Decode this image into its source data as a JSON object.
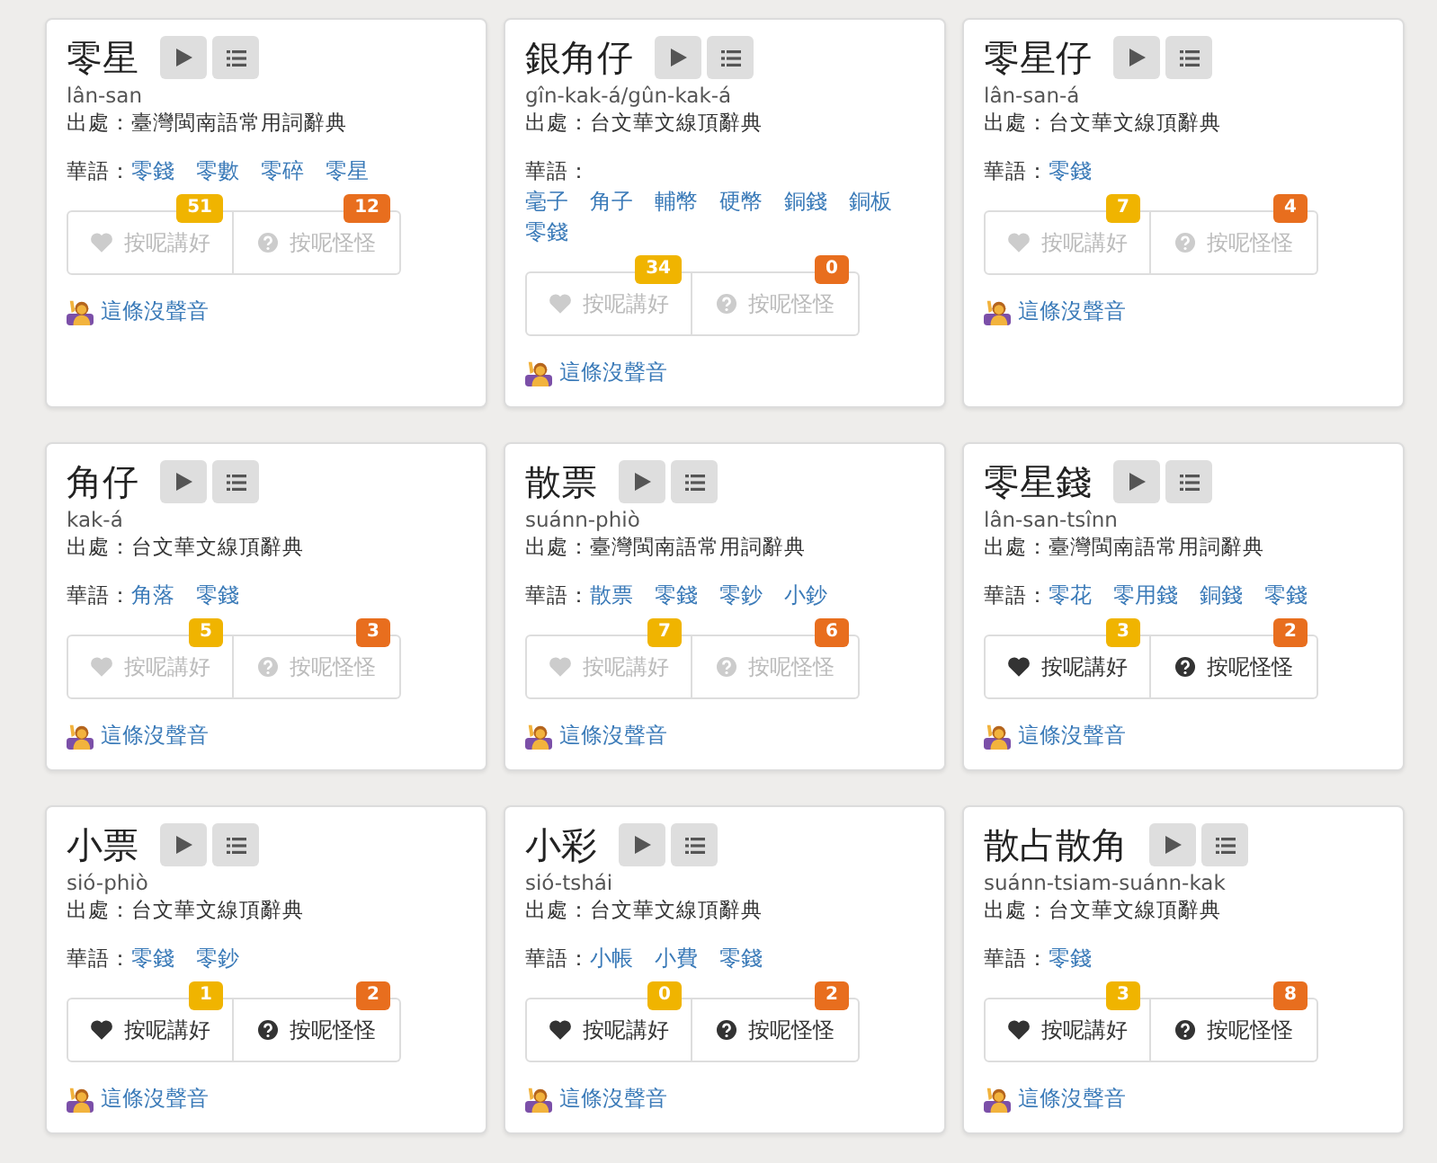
{
  "cards": [
    {
      "word": "零星",
      "romanization": "lân-san",
      "source": "出處：臺灣閩南語常用詞辭典",
      "mandarin_label": "華語：",
      "mandarin": [
        "零錢",
        "零數",
        "零碎",
        "零星"
      ],
      "disabled": true,
      "votes": [
        {
          "kind": "good",
          "label": "按呢講好",
          "count": "51"
        },
        {
          "kind": "odd",
          "label": "按呢怪怪",
          "count": "12"
        }
      ],
      "no_audio": "這條沒聲音"
    },
    {
      "word": "銀角仔",
      "romanization": "gîn-kak-á/gûn-kak-á",
      "source": "出處：台文華文線頂辭典",
      "mandarin_label": "華語：",
      "mandarin": [
        "毫子",
        "角子",
        "輔幣",
        "硬幣",
        "銅錢",
        "銅板",
        "零錢"
      ],
      "disabled": true,
      "votes": [
        {
          "kind": "good",
          "label": "按呢講好",
          "count": "34"
        },
        {
          "kind": "odd",
          "label": "按呢怪怪",
          "count": "0"
        }
      ],
      "no_audio": "這條沒聲音"
    },
    {
      "word": "零星仔",
      "romanization": "lân-san-á",
      "source": "出處：台文華文線頂辭典",
      "mandarin_label": "華語：",
      "mandarin": [
        "零錢"
      ],
      "disabled": true,
      "votes": [
        {
          "kind": "good",
          "label": "按呢講好",
          "count": "7"
        },
        {
          "kind": "odd",
          "label": "按呢怪怪",
          "count": "4"
        }
      ],
      "no_audio": "這條沒聲音"
    },
    {
      "word": "角仔",
      "romanization": "kak-á",
      "source": "出處：台文華文線頂辭典",
      "mandarin_label": "華語：",
      "mandarin": [
        "角落",
        "零錢"
      ],
      "disabled": true,
      "votes": [
        {
          "kind": "good",
          "label": "按呢講好",
          "count": "5"
        },
        {
          "kind": "odd",
          "label": "按呢怪怪",
          "count": "3"
        }
      ],
      "no_audio": "這條沒聲音"
    },
    {
      "word": "散票",
      "romanization": "suánn-phiò",
      "source": "出處：臺灣閩南語常用詞辭典",
      "mandarin_label": "華語：",
      "mandarin": [
        "散票",
        "零錢",
        "零鈔",
        "小鈔"
      ],
      "disabled": true,
      "votes": [
        {
          "kind": "good",
          "label": "按呢講好",
          "count": "7"
        },
        {
          "kind": "odd",
          "label": "按呢怪怪",
          "count": "6"
        }
      ],
      "no_audio": "這條沒聲音"
    },
    {
      "word": "零星錢",
      "romanization": "lân-san-tsînn",
      "source": "出處：臺灣閩南語常用詞辭典",
      "mandarin_label": "華語：",
      "mandarin": [
        "零花",
        "零用錢",
        "銅錢",
        "零錢"
      ],
      "disabled": false,
      "votes": [
        {
          "kind": "good",
          "label": "按呢講好",
          "count": "3"
        },
        {
          "kind": "odd",
          "label": "按呢怪怪",
          "count": "2"
        }
      ],
      "no_audio": "這條沒聲音"
    },
    {
      "word": "小票",
      "romanization": "sió-phiò",
      "source": "出處：台文華文線頂辭典",
      "mandarin_label": "華語：",
      "mandarin": [
        "零錢",
        "零鈔"
      ],
      "disabled": false,
      "votes": [
        {
          "kind": "good",
          "label": "按呢講好",
          "count": "1"
        },
        {
          "kind": "odd",
          "label": "按呢怪怪",
          "count": "2"
        }
      ],
      "no_audio": "這條沒聲音"
    },
    {
      "word": "小彩",
      "romanization": "sió-tshái",
      "source": "出處：台文華文線頂辭典",
      "mandarin_label": "華語：",
      "mandarin": [
        "小帳",
        "小費",
        "零錢"
      ],
      "disabled": false,
      "votes": [
        {
          "kind": "good",
          "label": "按呢講好",
          "count": "0"
        },
        {
          "kind": "odd",
          "label": "按呢怪怪",
          "count": "2"
        }
      ],
      "no_audio": "這條沒聲音"
    },
    {
      "word": "散占散角",
      "romanization": "suánn-tsiam-suánn-kak",
      "source": "出處：台文華文線頂辭典",
      "mandarin_label": "華語：",
      "mandarin": [
        "零錢"
      ],
      "disabled": false,
      "votes": [
        {
          "kind": "good",
          "label": "按呢講好",
          "count": "3"
        },
        {
          "kind": "odd",
          "label": "按呢怪怪",
          "count": "8"
        }
      ],
      "no_audio": "這條沒聲音"
    }
  ]
}
